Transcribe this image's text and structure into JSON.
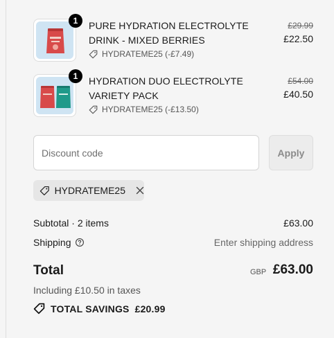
{
  "items": [
    {
      "title": "PURE HYDRATION ELECTROLYTE DRINK - MIXED BERRIES",
      "quantity": "1",
      "discount": "HYDRATEME25 (-£7.49)",
      "original_price": "£29.99",
      "price": "£22.50",
      "image_color": "#d84a4a"
    },
    {
      "title": "HYDRATION DUO ELECTROLYTE VARIETY PACK",
      "quantity": "1",
      "discount": "HYDRATEME25 (-£13.50)",
      "original_price": "£54.00",
      "price": "£40.50",
      "image_colors": [
        "#d84a4a",
        "#1f9a8a"
      ]
    }
  ],
  "discount": {
    "placeholder": "Discount code",
    "apply_label": "Apply",
    "applied_code": "HYDRATEME25"
  },
  "summary": {
    "subtotal_label": "Subtotal · 2 items",
    "subtotal_value": "£63.00",
    "shipping_label": "Shipping",
    "shipping_value": "Enter shipping address",
    "total_label": "Total",
    "currency": "GBP",
    "total_value": "£63.00",
    "taxes_note": "Including £10.50 in taxes",
    "savings_label": "TOTAL SAVINGS",
    "savings_value": "£20.99"
  },
  "colors": {
    "background": "#f5f5f5",
    "badge": "#000000",
    "thumbnail_bg": "#cfe4f3"
  }
}
